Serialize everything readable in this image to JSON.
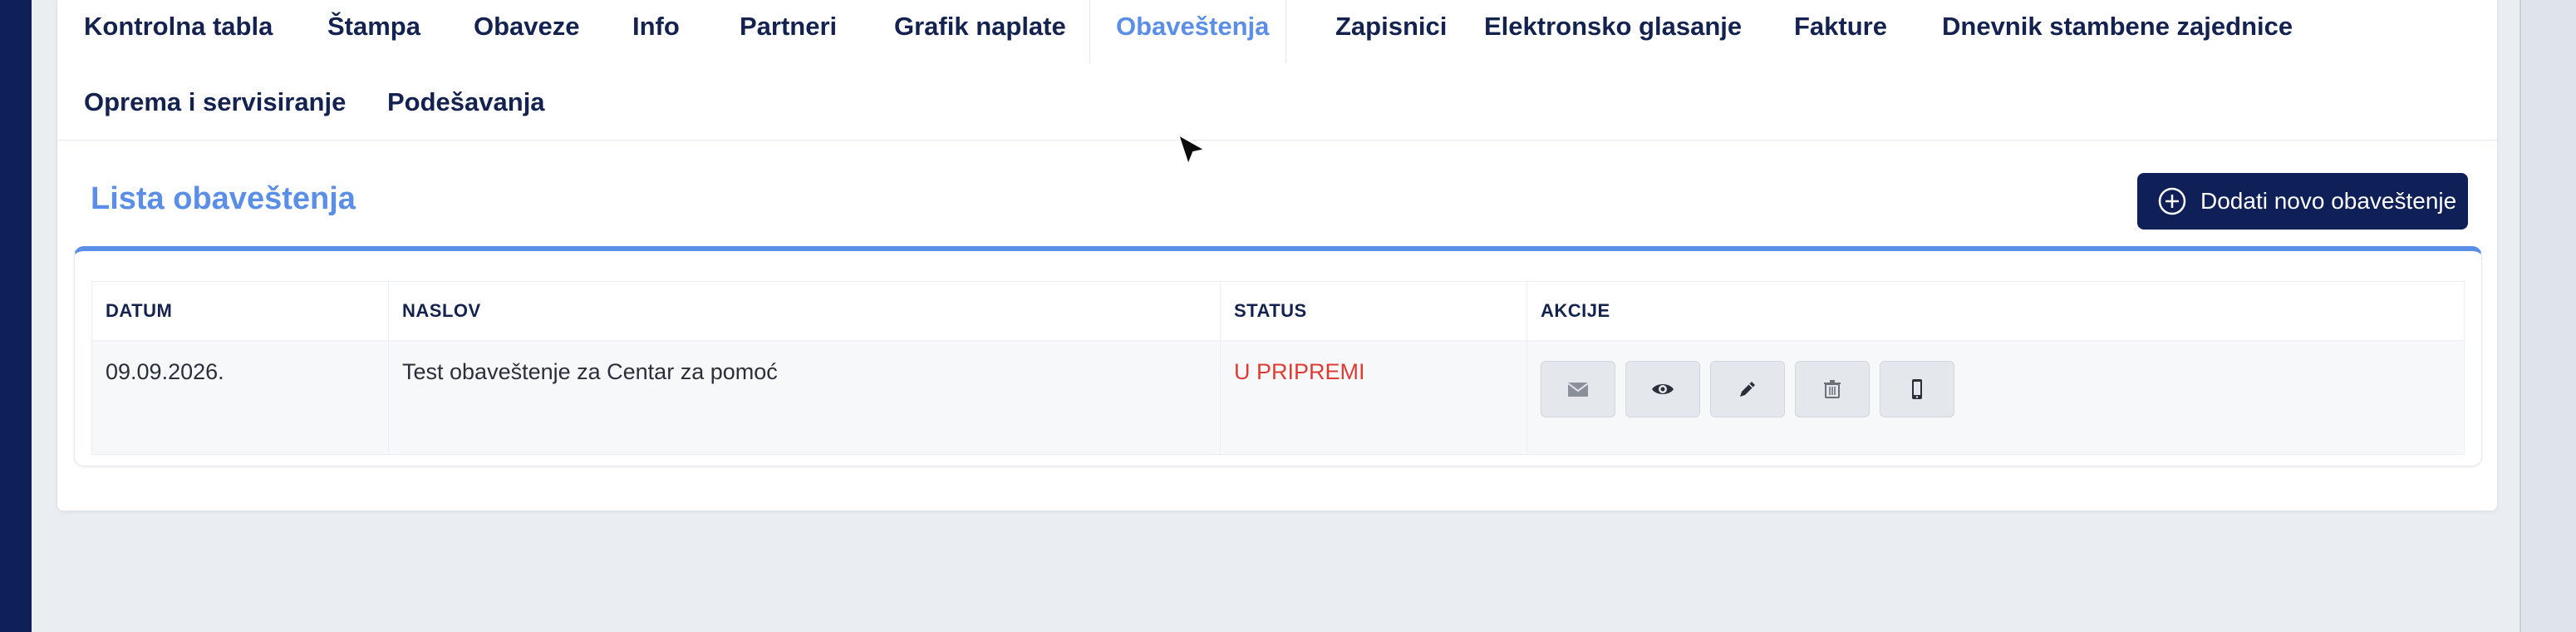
{
  "nav": {
    "tabs": [
      {
        "label": "Kontrolna tabla"
      },
      {
        "label": "Štampa"
      },
      {
        "label": "Obaveze"
      },
      {
        "label": "Info"
      },
      {
        "label": "Partneri"
      },
      {
        "label": "Grafik naplate"
      },
      {
        "label": "Obaveštenja",
        "active": true
      },
      {
        "label": "Zapisnici"
      },
      {
        "label": "Elektronsko glasanje"
      },
      {
        "label": "Fakture"
      },
      {
        "label": "Dnevnik stambene zajednice"
      },
      {
        "label": "Oprema i servisiranje"
      },
      {
        "label": "Podešavanja"
      }
    ]
  },
  "section": {
    "title": "Lista obaveštenja",
    "add_button_label": "Dodati novo obaveštenje",
    "add_button_icon": "plus-circle-icon"
  },
  "table": {
    "columns": [
      "DATUM",
      "NASLOV",
      "STATUS",
      "AKCIJE"
    ],
    "rows": [
      {
        "date": "09.09.2026.",
        "title": "Test obaveštenje za Centar za pomoć",
        "status": "U PRIPREMI",
        "actions": [
          "envelope-icon",
          "eye-icon",
          "pencil-icon",
          "trash-icon",
          "mobile-icon"
        ]
      }
    ]
  },
  "colors": {
    "accent": "#5b8ee6",
    "navy": "#0f1f57",
    "status_draft": "#e03b32"
  }
}
